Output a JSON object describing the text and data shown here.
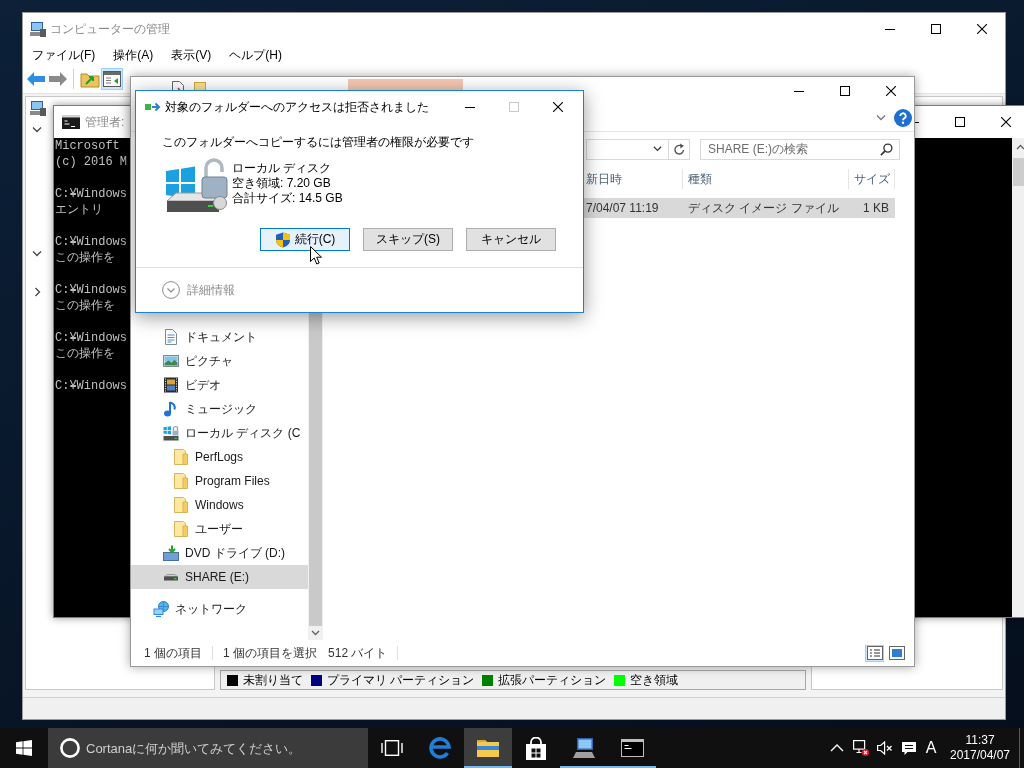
{
  "management_window": {
    "title": "コンピューターの管理",
    "menu": [
      "ファイル(F)",
      "操作(A)",
      "表示(V)",
      "ヘルプ(H)"
    ],
    "toolbar": [
      {
        "kind": "back",
        "disabled": false,
        "pressed": false
      },
      {
        "kind": "forward",
        "disabled": true,
        "pressed": false
      },
      {
        "kind": "up",
        "disabled": false,
        "pressed": false
      },
      {
        "kind": "pane",
        "disabled": false,
        "pressed": true
      }
    ],
    "tree": [
      {
        "expanded": true
      },
      {
        "expanded": true
      },
      {
        "expanded": false
      }
    ],
    "legend": [
      {
        "label": "未割り当て",
        "color": "#000000"
      },
      {
        "label": "プライマリ パーティション",
        "color": "#000080"
      },
      {
        "label": "拡張パーティション",
        "color": "#008000"
      },
      {
        "label": "空き領域",
        "color": "#00ff00"
      }
    ]
  },
  "console_window": {
    "title": "管理者:",
    "paragraphs": [
      [
        "Microsoft",
        "(c) 2016 M"
      ],
      [
        "C:¥Windows",
        "エントリ"
      ],
      [
        "C:¥Windows",
        "この操作を"
      ],
      [
        "C:¥Windows",
        "この操作を"
      ],
      [
        "C:¥Windows",
        "この操作を"
      ],
      [
        "C:¥Windows"
      ]
    ]
  },
  "explorer_window": {
    "search": {
      "placeholder": "SHARE (E:)の検索"
    },
    "nav_tree": [
      {
        "children": [
          {
            "label": "ドキュメント",
            "kind": "documents",
            "selected": false
          },
          {
            "label": "ピクチャ",
            "kind": "pictures",
            "selected": false
          },
          {
            "label": "ビデオ",
            "kind": "videos",
            "selected": false
          },
          {
            "label": "ミュージック",
            "kind": "music",
            "selected": false
          },
          {
            "label": "ローカル ディスク (C",
            "kind": "system_disk",
            "selected": false,
            "children": [
              {
                "label": "PerfLogs",
                "kind": "folder",
                "selected": false
              },
              {
                "label": "Program Files",
                "kind": "folder",
                "selected": false
              },
              {
                "label": "Windows",
                "kind": "folder",
                "selected": false
              },
              {
                "label": "ユーザー",
                "kind": "folder",
                "selected": false
              }
            ]
          },
          {
            "label": "DVD ドライブ (D:)",
            "kind": "dvd",
            "selected": false
          },
          {
            "label": "SHARE (E:)",
            "kind": "drive",
            "selected": true
          }
        ]
      },
      {
        "label": "ネットワーク",
        "kind": "network",
        "selected": false
      }
    ],
    "columns": [
      "新日時",
      "種類",
      "サイズ"
    ],
    "rows": [
      {
        "cells": [
          "7/04/07 11:19",
          "ディスク イメージ ファイル",
          "1 KB"
        ],
        "selected": true
      }
    ],
    "status": [
      "1 個の項目",
      "1 個の項目を選択",
      "512 バイト"
    ],
    "views": [
      {
        "kind": "details",
        "selected": true
      },
      {
        "kind": "tiles",
        "selected": false
      }
    ]
  },
  "dialog": {
    "title": "対象のフォルダーへのアクセスは拒否されました",
    "maximize_disabled": true,
    "message": "このフォルダーへコピーするには管理者の権限が必要です",
    "target": {
      "name": "ローカル ディスク",
      "free": "空き領域: 7.20 GB",
      "total": "合計サイズ: 14.5 GB"
    },
    "buttons": [
      {
        "label": "続行(C)",
        "shield": true,
        "hover": true
      },
      {
        "label": "スキップ(S)",
        "shield": false,
        "hover": false
      },
      {
        "label": "キャンセル",
        "shield": false,
        "hover": false
      }
    ],
    "details": {
      "label": "詳細情報",
      "expanded": false
    }
  },
  "taskbar": {
    "search": {
      "placeholder": "Cortanaに何か聞いてみてください。"
    },
    "apps": [
      {
        "kind": "browser",
        "running": false,
        "active": false
      },
      {
        "kind": "files",
        "running": true,
        "active": true
      },
      {
        "kind": "store",
        "running": false,
        "active": false
      },
      {
        "kind": "management",
        "running": true,
        "active": false
      },
      {
        "kind": "console",
        "running": true,
        "active": false
      }
    ],
    "ime": "A",
    "time": "11:37",
    "date": "2017/04/07"
  }
}
